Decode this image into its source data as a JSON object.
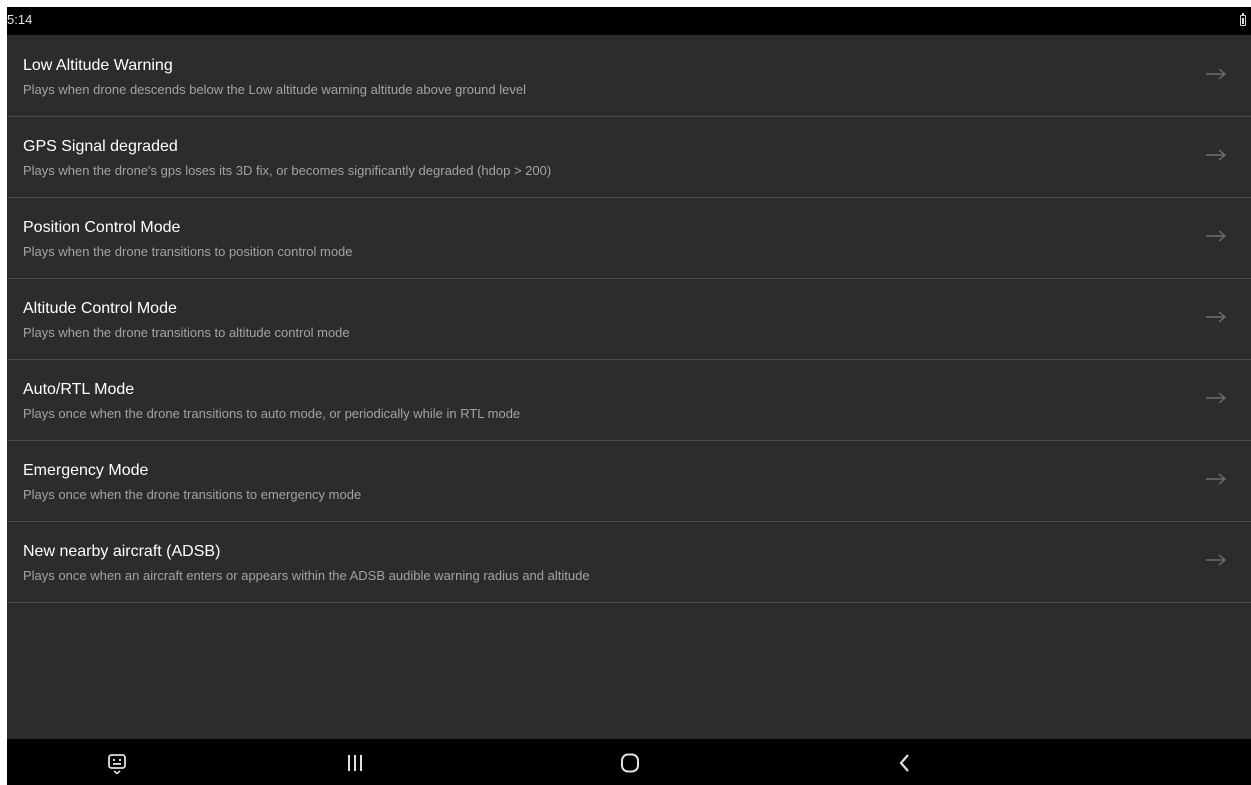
{
  "status_bar": {
    "time": "5:14"
  },
  "settings_list": {
    "items": [
      {
        "title": "Low Altitude Warning",
        "description": "Plays when drone descends below the Low altitude warning altitude above ground level"
      },
      {
        "title": "GPS Signal degraded",
        "description": "Plays when the drone's gps loses its 3D fix, or becomes significantly degraded (hdop > 200)"
      },
      {
        "title": "Position Control Mode",
        "description": "Plays when the drone transitions to position control mode"
      },
      {
        "title": "Altitude Control Mode",
        "description": "Plays when the drone transitions to altitude control mode"
      },
      {
        "title": "Auto/RTL Mode",
        "description": "Plays once when the drone transitions to auto mode, or periodically while in RTL mode"
      },
      {
        "title": "Emergency Mode",
        "description": "Plays once when the drone transitions to emergency mode"
      },
      {
        "title": "New nearby aircraft (ADSB)",
        "description": "Plays once when an aircraft enters or appears within the ADSB audible warning radius and altitude"
      }
    ]
  },
  "icons": {
    "status_battery": "battery-icon",
    "row_chevron": "arrow-right-icon",
    "nav_keyboard": "keyboard-toggle-icon",
    "nav_recents": "recents-icon",
    "nav_home": "home-icon",
    "nav_back": "back-icon"
  },
  "colors": {
    "background": "#2c2c2c",
    "bars": "#000000",
    "title_text": "#ffffff",
    "description_text": "#a3a3a3",
    "divider": "#4a4a4a",
    "arrow": "#6e6e6e"
  }
}
